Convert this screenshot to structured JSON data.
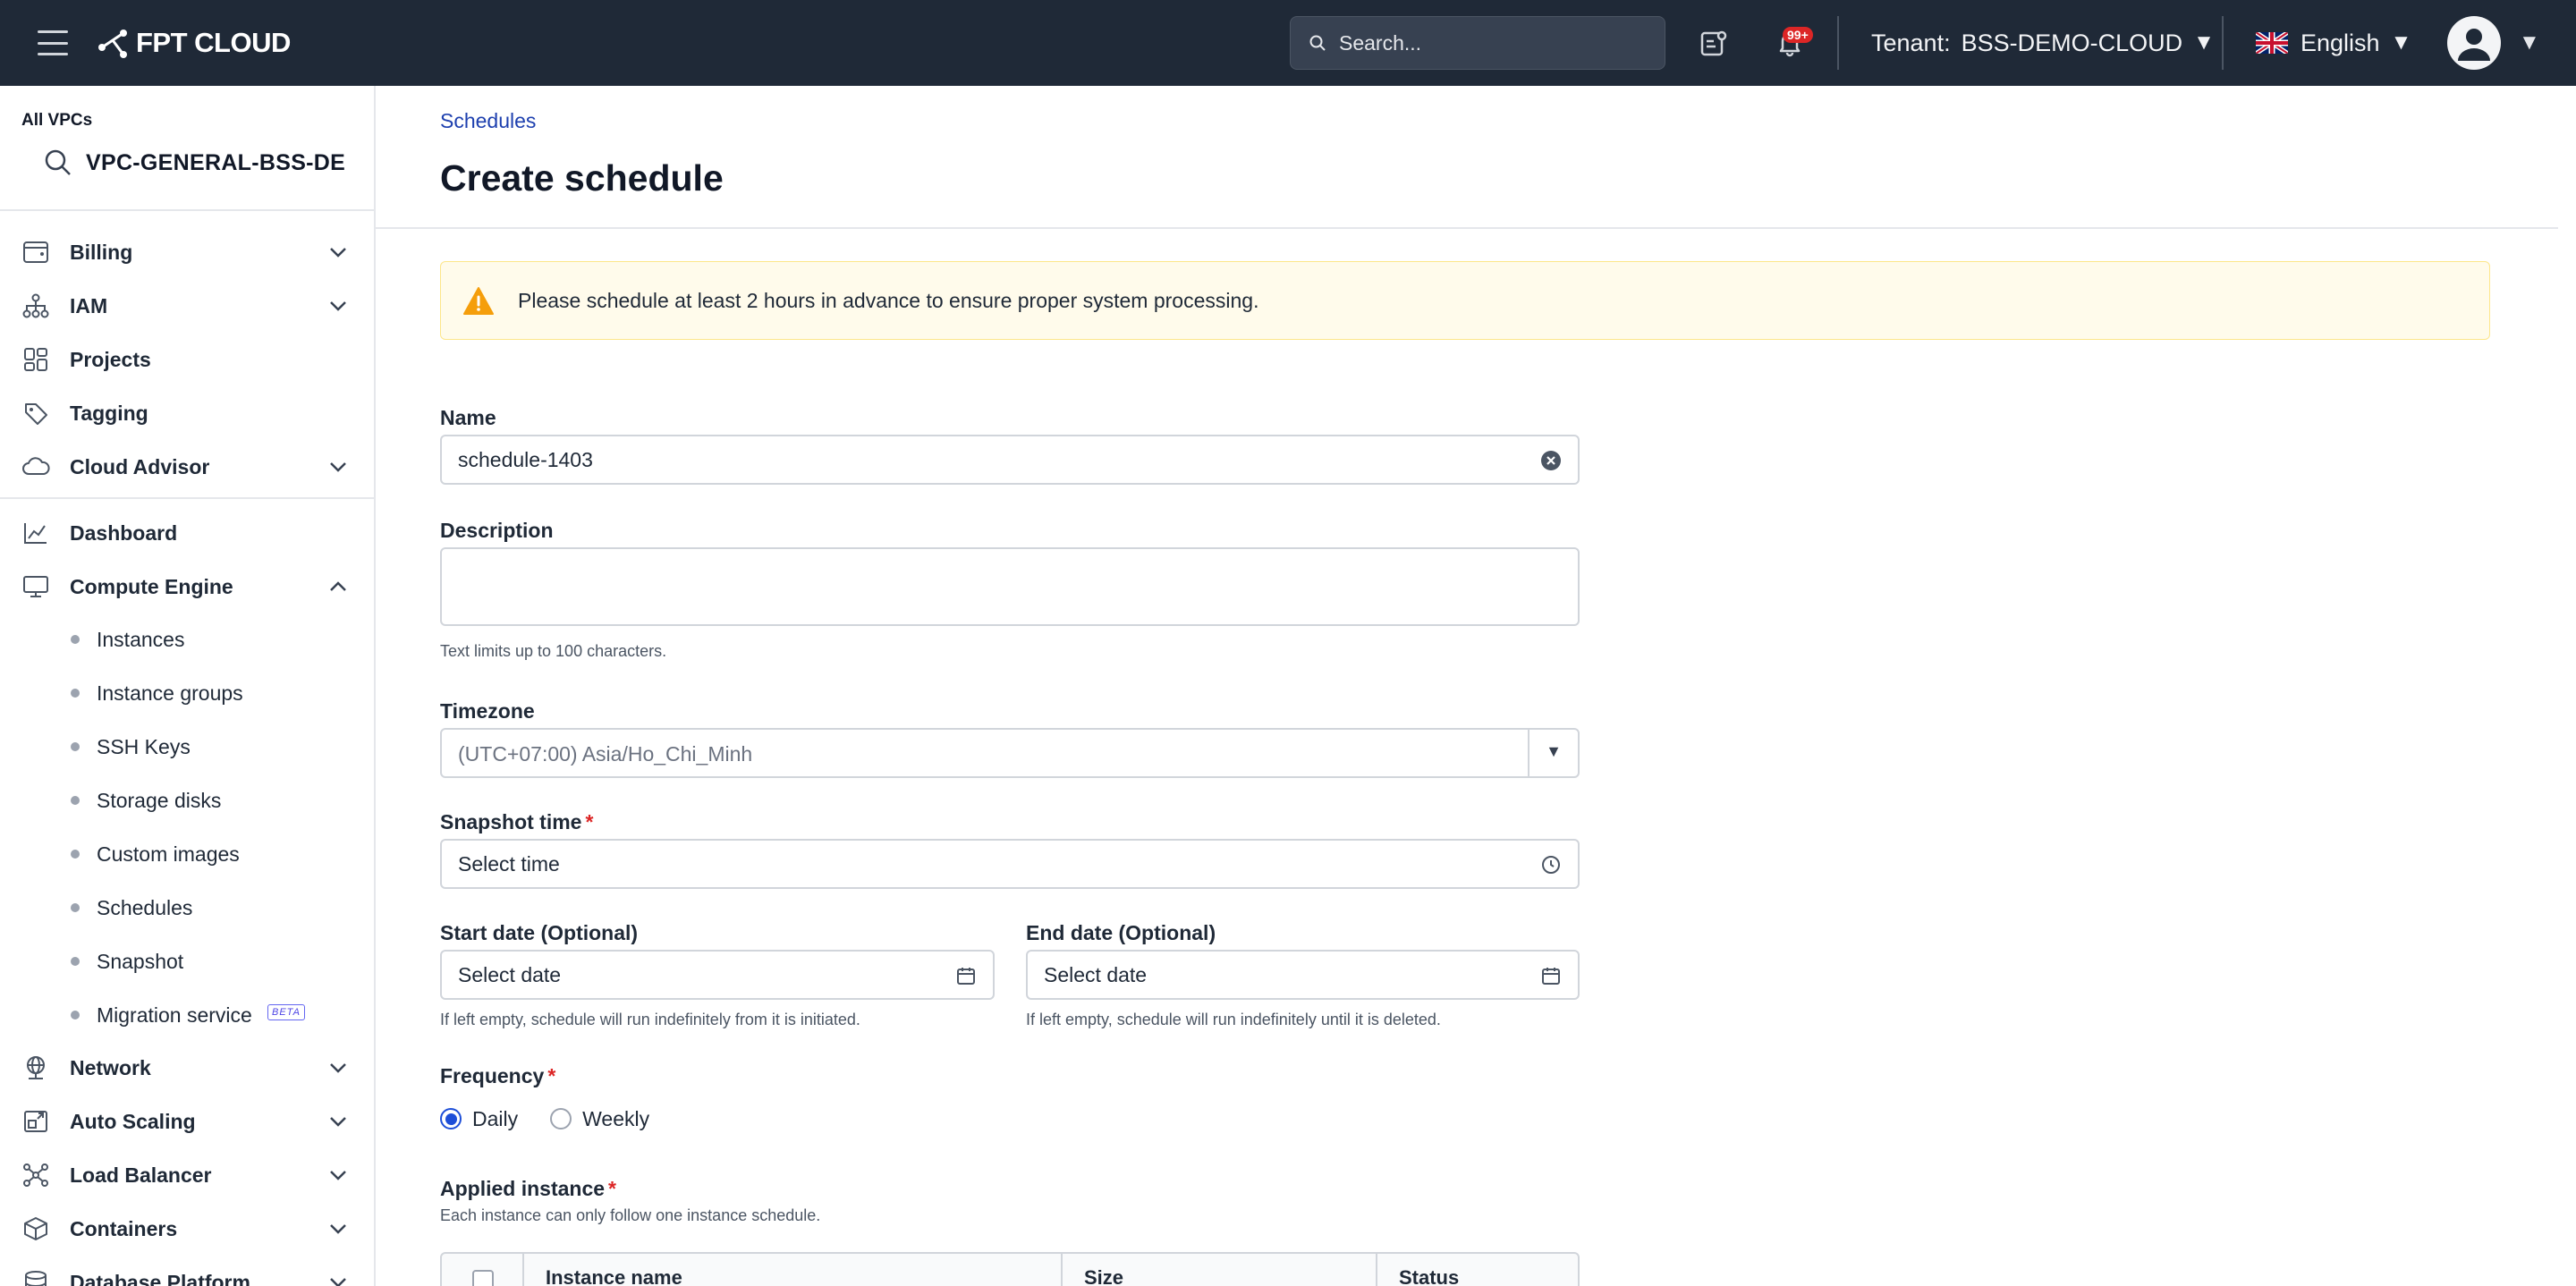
{
  "header": {
    "logo_text": "FPT CLOUD",
    "search_placeholder": "Search...",
    "notification_count": "99+",
    "tenant_label": "Tenant:",
    "tenant_value": "BSS-DEMO-CLOUD",
    "language": "English"
  },
  "sidebar": {
    "vpc_label": "All VPCs",
    "vpc_value": "VPC-GENERAL-BSS-DE",
    "groups": [
      {
        "label": "Billing",
        "icon": "wallet-icon",
        "expandable": true
      },
      {
        "label": "IAM",
        "icon": "hierarchy-icon",
        "expandable": true
      },
      {
        "label": "Projects",
        "icon": "grid-icon",
        "expandable": false
      },
      {
        "label": "Tagging",
        "icon": "tag-icon",
        "expandable": false
      },
      {
        "label": "Cloud Advisor",
        "icon": "cloud-icon",
        "expandable": true
      }
    ],
    "dashboard": "Dashboard",
    "compute_engine": "Compute Engine",
    "compute_items": [
      "Instances",
      "Instance groups",
      "SSH Keys",
      "Storage disks",
      "Custom images",
      "Schedules",
      "Snapshot",
      "Migration service"
    ],
    "beta_badge": "BETA",
    "bottom_items": [
      "Network",
      "Auto Scaling",
      "Load Balancer",
      "Containers",
      "Database Platform"
    ]
  },
  "main": {
    "breadcrumb": "Schedules",
    "title": "Create schedule",
    "alert": "Please schedule at least 2 hours in advance to ensure proper system processing.",
    "name_label": "Name",
    "name_value": "schedule-1403",
    "description_label": "Description",
    "description_help": "Text limits up to 100 characters.",
    "timezone_label": "Timezone",
    "timezone_value": "(UTC+07:00) Asia/Ho_Chi_Minh",
    "snapshot_label": "Snapshot time",
    "snapshot_placeholder": "Select time",
    "start_label": "Start date (Optional)",
    "start_placeholder": "Select date",
    "start_help": "If left empty, schedule will run indefinitely from it is initiated.",
    "end_label": "End date (Optional)",
    "end_placeholder": "Select date",
    "end_help": "If left empty, schedule will run indefinitely until it is deleted.",
    "frequency_label": "Frequency",
    "freq_daily": "Daily",
    "freq_weekly": "Weekly",
    "applied_label": "Applied instance",
    "applied_help": "Each instance can only follow one instance schedule.",
    "table_columns": [
      "Instance name",
      "Size",
      "Status"
    ],
    "required_mark": "*"
  }
}
